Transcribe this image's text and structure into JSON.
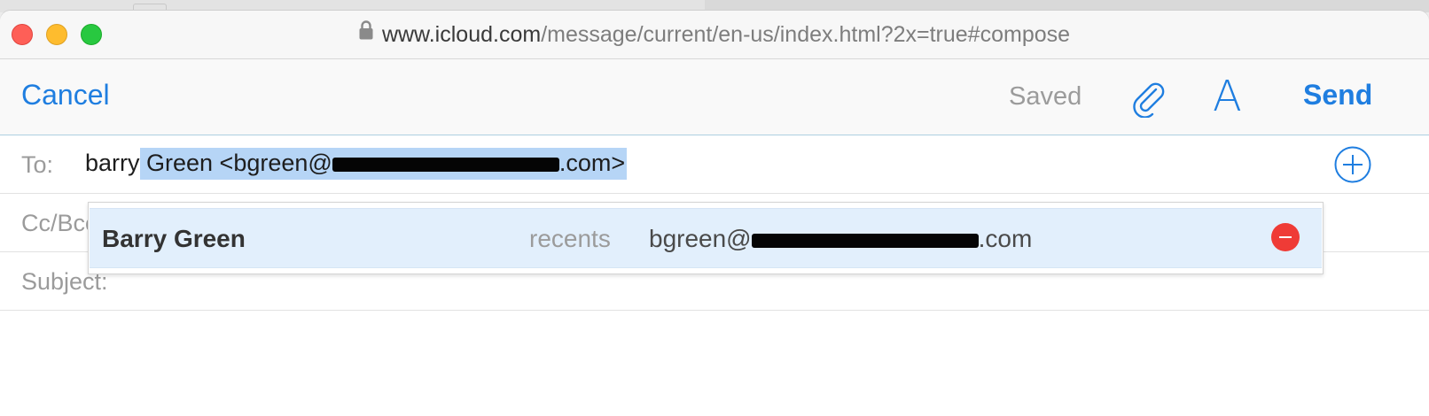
{
  "browser": {
    "url_host": "www.icloud.com",
    "url_path": "/message/current/en-us/index.html?2x=true#compose"
  },
  "toolbar": {
    "cancel_label": "Cancel",
    "saved_label": "Saved",
    "font_label": "A",
    "send_label": "Send"
  },
  "fields": {
    "to_label": "To:",
    "to_prefix": "barry",
    "to_selected_start": " Green <bgreen@",
    "to_selected_end": ".com>",
    "cc_label": "Cc/Bcc:",
    "subject_label": "Subject:"
  },
  "suggestion": {
    "name": "Barry Green",
    "source": "recents",
    "email_start": "bgreen@",
    "email_end": ".com"
  },
  "colors": {
    "accent": "#1f7ee0",
    "selection": "#b6d5f6",
    "suggestion_bg": "#e2effc",
    "remove": "#ef3b36"
  }
}
